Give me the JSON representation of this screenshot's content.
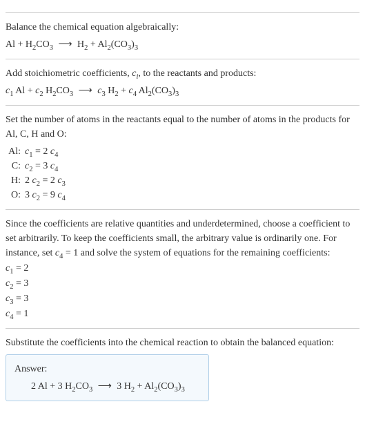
{
  "step1": {
    "title": "Balance the chemical equation algebraically:",
    "eq_left1": "Al + H",
    "eq_left2": "2",
    "eq_left3": "CO",
    "eq_left4": "3",
    "arrow": "⟶",
    "eq_right1": "H",
    "eq_right2": "2",
    "eq_right3": " + Al",
    "eq_right4": "2",
    "eq_right5": "(CO",
    "eq_right6": "3",
    "eq_right7": ")",
    "eq_right8": "3"
  },
  "step2": {
    "title1": "Add stoichiometric coefficients, ",
    "title_ci": "c",
    "title_ci_sub": "i",
    "title2": ", to the reactants and products:",
    "c1": "c",
    "c1s": "1",
    "t1": " Al + ",
    "c2": "c",
    "c2s": "2",
    "t2": " H",
    "t2s": "2",
    "t3": "CO",
    "t3s": "3",
    "arrow": "⟶",
    "c3": "c",
    "c3s": "3",
    "t4": " H",
    "t4s": "2",
    "t5": " + ",
    "c4": "c",
    "c4s": "4",
    "t6": " Al",
    "t6s": "2",
    "t7": "(CO",
    "t7s": "3",
    "t8": ")",
    "t8s": "3"
  },
  "step3": {
    "title": "Set the number of atoms in the reactants equal to the number of atoms in the products for Al, C, H and O:",
    "rows": [
      {
        "label": "Al:",
        "lhs_c": "c",
        "lhs_s": "1",
        "mid": " = 2 ",
        "rhs_c": "c",
        "rhs_s": "4"
      },
      {
        "label": "C:",
        "lhs_c": "c",
        "lhs_s": "2",
        "mid": " = 3 ",
        "rhs_c": "c",
        "rhs_s": "4"
      },
      {
        "label": "H:",
        "pre": "2 ",
        "lhs_c": "c",
        "lhs_s": "2",
        "mid": " = 2 ",
        "rhs_c": "c",
        "rhs_s": "3"
      },
      {
        "label": "O:",
        "pre": "3 ",
        "lhs_c": "c",
        "lhs_s": "2",
        "mid": " = 9 ",
        "rhs_c": "c",
        "rhs_s": "4"
      }
    ]
  },
  "step4": {
    "title": "Since the coefficients are relative quantities and underdetermined, choose a coefficient to set arbitrarily. To keep the coefficients small, the arbitrary value is ordinarily one. For instance, set ",
    "set_c": "c",
    "set_s": "4",
    "set_rest": " = 1 and solve the system of equations for the remaining coefficients:",
    "coeffs": [
      {
        "c": "c",
        "s": "1",
        "v": " = 2"
      },
      {
        "c": "c",
        "s": "2",
        "v": " = 3"
      },
      {
        "c": "c",
        "s": "3",
        "v": " = 3"
      },
      {
        "c": "c",
        "s": "4",
        "v": " = 1"
      }
    ]
  },
  "step5": {
    "title": "Substitute the coefficients into the chemical reaction to obtain the balanced equation:",
    "answer_label": "Answer:",
    "eq1": "2 Al + 3 H",
    "eq1s": "2",
    "eq2": "CO",
    "eq2s": "3",
    "arrow": "⟶",
    "eq3": "3 H",
    "eq3s": "2",
    "eq4": " + Al",
    "eq4s": "2",
    "eq5": "(CO",
    "eq5s": "3",
    "eq6": ")",
    "eq6s": "3"
  }
}
